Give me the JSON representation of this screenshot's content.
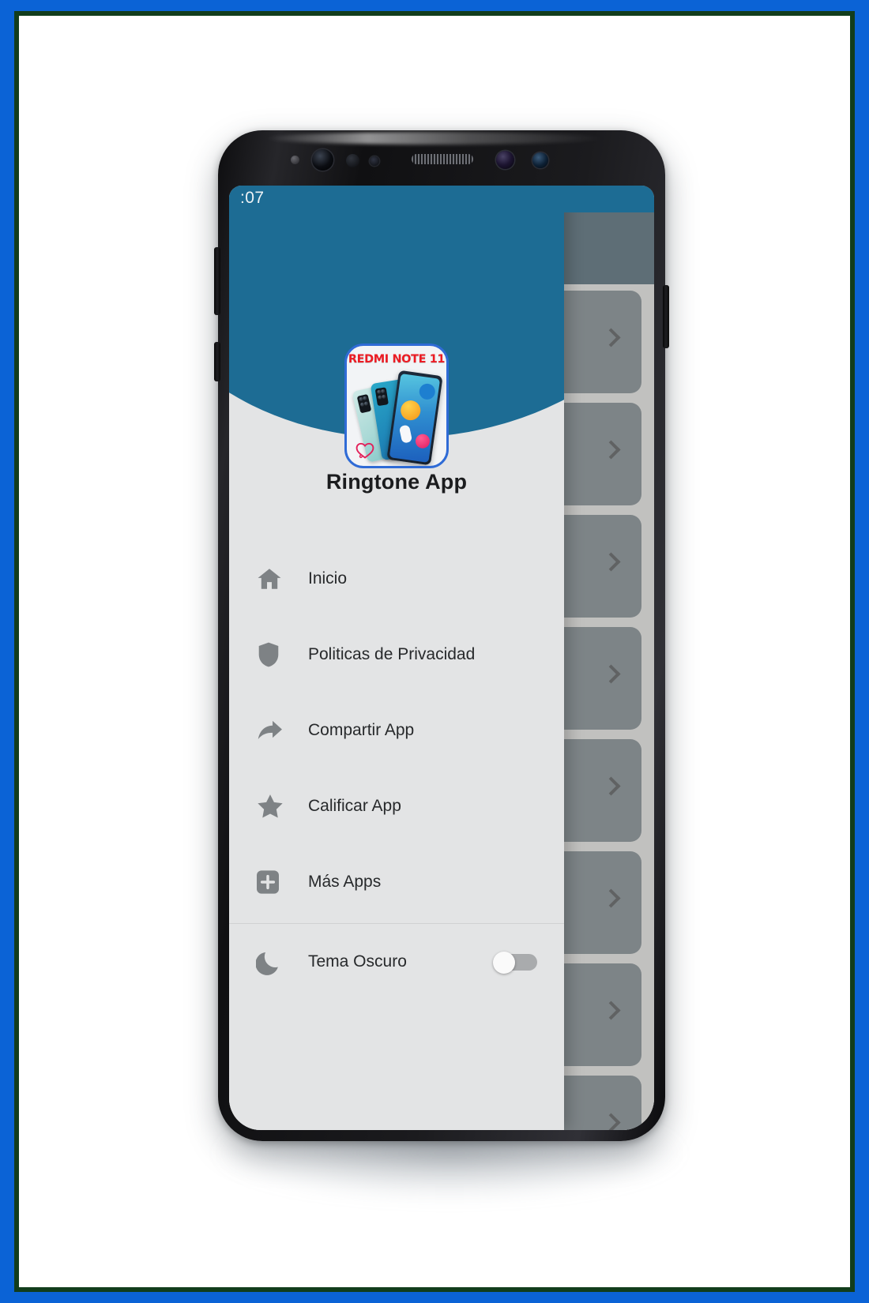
{
  "device": {
    "type": "android-phone-mockup",
    "status_bar": {
      "time": ":07"
    }
  },
  "drawer": {
    "app_icon": {
      "name": "redmi-note-11-app-icon",
      "badge_text": "REDMI NOTE 11",
      "badge_color": "#ec1c24",
      "frame_color": "#2f6bd6"
    },
    "header_color": "#1d6c94",
    "title": "Ringtone App",
    "items": [
      {
        "id": "inicio",
        "label": "Inicio",
        "icon": "home-icon"
      },
      {
        "id": "privacidad",
        "label": "Politicas de Privacidad",
        "icon": "shield-icon"
      },
      {
        "id": "compartir",
        "label": "Compartir App",
        "icon": "share-arrow-icon"
      },
      {
        "id": "calificar",
        "label": "Calificar App",
        "icon": "star-icon"
      },
      {
        "id": "mas-apps",
        "label": "Más Apps",
        "icon": "plus-box-icon"
      }
    ],
    "theme_toggle": {
      "label": "Tema Oscuro",
      "icon": "moon-icon",
      "state": "off"
    }
  },
  "backdrop": {
    "appbar_color": "#1d3b4d",
    "card_color": "#55636c",
    "card_count": 8,
    "card_chevron_icon": "chevron-right-icon"
  },
  "frame": {
    "outer_color": "#0b63d6",
    "inner_line_color": "#123d1c",
    "page_color": "#ffffff"
  }
}
